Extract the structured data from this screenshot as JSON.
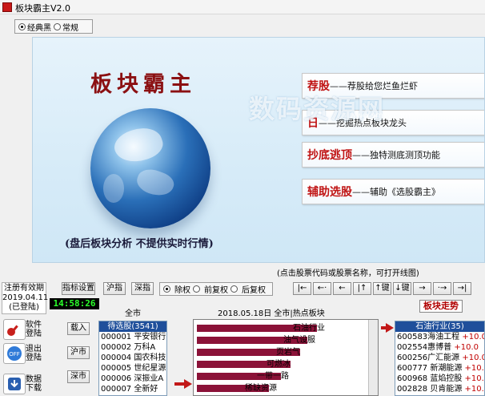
{
  "window": {
    "title": "板块霸主V2.0"
  },
  "theme_group": {
    "options": [
      "经典黑",
      "常规"
    ],
    "selected": "经典黑"
  },
  "banner": {
    "title": "板块霸主",
    "note": "(盘后板块分析  不提供实时行情)",
    "features": [
      {
        "heading": "荐股",
        "desc": "——荐股给您烂鱼烂虾"
      },
      {
        "heading": "日",
        "desc": "——挖掘热点板块龙头"
      },
      {
        "heading": "抄底逃顶",
        "desc": "——独特测底测顶功能"
      },
      {
        "heading": "辅助选股",
        "desc": "——辅助《选股霸主》"
      }
    ],
    "watermark": "数码资源网",
    "watermark_url": "www.smzy.com"
  },
  "hint_text": "(点击股票代码或股票名称，可打开线图)",
  "registration": {
    "line1": "注册有效期",
    "line2": "2019.04.11",
    "line3": "(已登陆)"
  },
  "clock": "14:58:26",
  "toolbar": {
    "btn_index_setting": "指标设置",
    "btn_sh": "沪指",
    "btn_sz": "深指",
    "weight_options": [
      "除权",
      "前复权",
      "后复权"
    ],
    "weight_selected": "除权",
    "nav": [
      "|←",
      "←·",
      "←",
      "|↑",
      "↑键",
      "↓键",
      "→",
      "·→",
      "→|"
    ]
  },
  "label_market": "全市",
  "chart_header": "2018.05.18日 全市|热点板块",
  "btn_sector_trend": "板块走势",
  "side": {
    "exit_label": "软件\n登陆",
    "logout_label": "退出\n登陆",
    "download_label": "数据\n下载"
  },
  "small_buttons": [
    "载入",
    "沪市",
    "深市"
  ],
  "stock_list": {
    "header": "待选股(3541)",
    "rows": [
      "000001 平安银行",
      "000002 万科A",
      "000004 国农科技",
      "000005 世纪星源",
      "000006 深振业A",
      "000007 全新好"
    ]
  },
  "chart_data": {
    "type": "bar",
    "title": "2018.05.18日 全市|热点板块",
    "categories": [
      "石油行业",
      "油气设服",
      "页岩气",
      "可燃冰",
      "一带一路",
      "稀缺资源"
    ],
    "values": [
      100,
      92,
      86,
      78,
      70,
      60
    ],
    "colors": {
      "bar": "#8b1238"
    }
  },
  "sector_list": {
    "header": "石油行业(35)",
    "rows": [
      {
        "name": "600583海油工程",
        "pct": "+10.0"
      },
      {
        "name": "002554惠博普",
        "pct": "+10.0"
      },
      {
        "name": "600256广汇能源",
        "pct": "+10.0"
      },
      {
        "name": "600777 新潮能源",
        "pct": "+10.0"
      },
      {
        "name": "600968 蓝焰控股",
        "pct": "+10.0"
      },
      {
        "name": "002828 贝肯能源",
        "pct": "+10.0"
      }
    ]
  },
  "colors": {
    "accent_red": "#c01414",
    "list_header": "#1f4f9b",
    "clock_green": "#2bff2b"
  }
}
